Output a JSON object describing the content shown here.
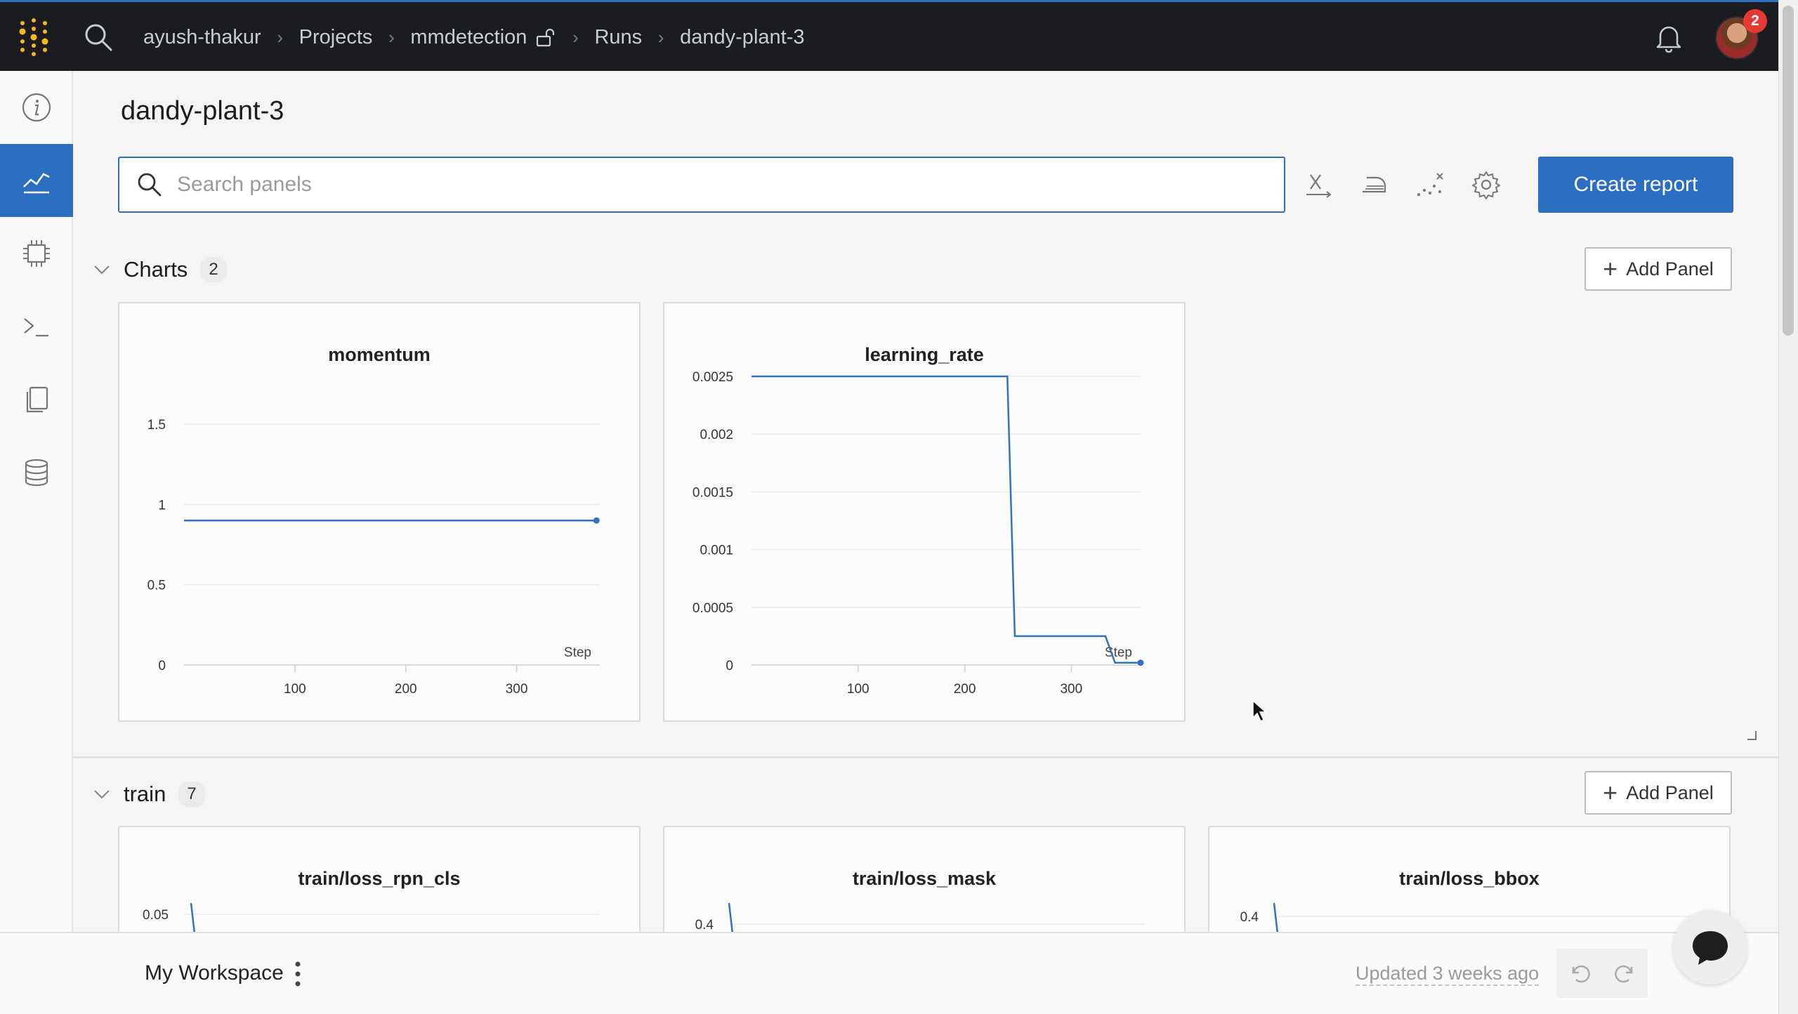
{
  "breadcrumb": [
    "ayush-thakur",
    "Projects",
    "mmdetection",
    "Runs",
    "dandy-plant-3"
  ],
  "notifications": {
    "count": "2"
  },
  "run": {
    "title": "dandy-plant-3"
  },
  "search": {
    "placeholder": "Search panels"
  },
  "toolbar": {
    "create_report": "Create report"
  },
  "sections": [
    {
      "name": "Charts",
      "count": "2",
      "add_panel": "Add Panel"
    },
    {
      "name": "train",
      "count": "7",
      "add_panel": "Add Panel"
    }
  ],
  "chart_data": [
    {
      "type": "line",
      "title": "momentum",
      "xlabel": "Step",
      "x_ticks": [
        "100",
        "200",
        "300"
      ],
      "y_ticks": [
        "0",
        "0.5",
        "1",
        "1.5"
      ],
      "xlim": [
        0,
        375
      ],
      "ylim": [
        0,
        1.5
      ],
      "series": [
        {
          "x": [
            0,
            372
          ],
          "y": [
            0.9,
            0.9
          ]
        }
      ]
    },
    {
      "type": "line",
      "title": "learning_rate",
      "xlabel": "Step",
      "x_ticks": [
        "100",
        "200",
        "300"
      ],
      "y_ticks": [
        "0",
        "0.0005",
        "0.001",
        "0.0015",
        "0.002",
        "0.0025"
      ],
      "xlim": [
        0,
        365
      ],
      "ylim": [
        0,
        0.0025
      ],
      "series": [
        {
          "x": [
            0,
            240,
            247,
            332,
            341,
            365
          ],
          "y": [
            0.0025,
            0.0025,
            0.00025,
            0.00025,
            2e-05,
            2e-05
          ]
        }
      ]
    },
    {
      "type": "line",
      "title": "train/loss_rpn_cls",
      "y_ticks": [
        "0.05"
      ]
    },
    {
      "type": "line",
      "title": "train/loss_mask",
      "y_ticks": [
        "0.4"
      ]
    },
    {
      "type": "line",
      "title": "train/loss_bbox",
      "y_ticks": [
        "0.4"
      ]
    }
  ],
  "footer": {
    "workspace": "My Workspace",
    "updated": "Updated 3 weeks ago"
  },
  "colors": {
    "accent": "#2c6fc2",
    "line": "#2f72c0",
    "topbar": "#1a1c1f"
  }
}
